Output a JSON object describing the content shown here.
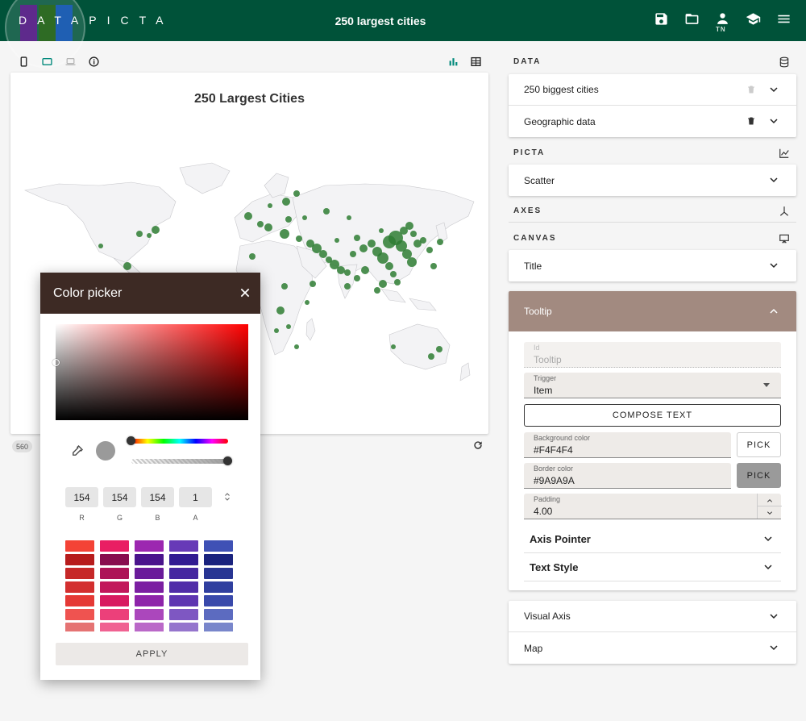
{
  "app": {
    "logo_text": "DATAPICTA",
    "title": "250 largest cities",
    "user_initials": "TN",
    "logo_colors": [
      "#5e2a8c",
      "#2e6b24",
      "#1f5fb3"
    ]
  },
  "toolbar_icons": [
    "phone-icon",
    "tablet-icon",
    "laptop-icon",
    "info-icon",
    "bar-chart-icon",
    "table-icon"
  ],
  "chart": {
    "title": "250 Largest Cities",
    "type": "scatter on world map",
    "land_color": "#f3f3f5",
    "point_color": "#2e7d32",
    "size_chips": [
      "560"
    ]
  },
  "right_panel": {
    "data_header": "DATA",
    "data_items": [
      "250 biggest cities",
      "Geographic data"
    ],
    "picta_header": "PICTA",
    "picta_items": [
      "Scatter"
    ],
    "axes_header": "AXES",
    "canvas_header": "CANVAS",
    "canvas_items": [
      "Title"
    ],
    "tooltip": {
      "header": "Tooltip",
      "id_label": "Id",
      "id_placeholder": "Tooltip",
      "trigger_label": "Trigger",
      "trigger_value": "Item",
      "compose_label": "COMPOSE TEXT",
      "bg_label": "Background color",
      "bg_value": "#F4F4F4",
      "border_label": "Border color",
      "border_value": "#9A9A9A",
      "padding_label": "Padding",
      "padding_value": "4.00",
      "pick_label": "PICK",
      "sub_sections": [
        "Axis Pointer",
        "Text Style"
      ]
    },
    "bottom_items": [
      "Visual Axis",
      "Map"
    ]
  },
  "color_picker": {
    "title": "Color picker",
    "r": "154",
    "g": "154",
    "b": "154",
    "a": "1",
    "r_label": "R",
    "g_label": "G",
    "b_label": "B",
    "a_label": "A",
    "apply_label": "APPLY",
    "palette_columns": [
      [
        "#f44336",
        "#b71c1c",
        "#c62828",
        "#d32f2f",
        "#e53935",
        "#ef5350",
        "#e57373"
      ],
      [
        "#e91e63",
        "#880e4f",
        "#ad1457",
        "#c2185b",
        "#d81b60",
        "#ec407a",
        "#f06292"
      ],
      [
        "#9c27b0",
        "#4a148c",
        "#6a1b9a",
        "#7b1fa2",
        "#8e24aa",
        "#ab47bc",
        "#ba68c8"
      ],
      [
        "#673ab7",
        "#311b92",
        "#4527a0",
        "#512da8",
        "#5e35b1",
        "#7e57c2",
        "#9575cd"
      ],
      [
        "#3f51b5",
        "#1a237e",
        "#283593",
        "#303f9f",
        "#3949ab",
        "#5c6bc0",
        "#7986cb"
      ]
    ]
  }
}
